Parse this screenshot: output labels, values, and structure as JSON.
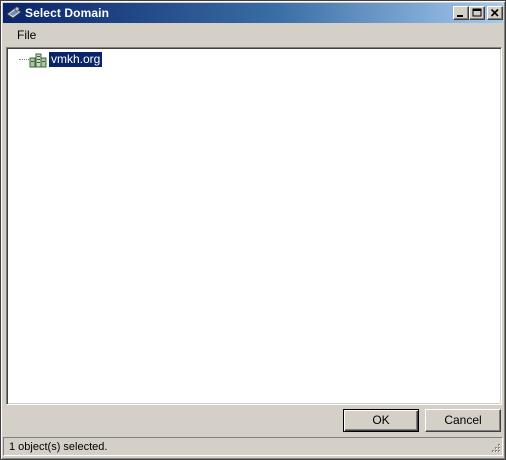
{
  "window": {
    "title": "Select Domain",
    "icon": "select-domain-app-icon"
  },
  "titlebar_buttons": {
    "minimize_icon": "minimize-icon",
    "maximize_icon": "maximize-icon",
    "close_icon": "close-icon"
  },
  "menu": {
    "items": [
      {
        "label": "File"
      }
    ]
  },
  "tree": {
    "nodes": [
      {
        "label": "vmkh.org",
        "icon": "domain-icon",
        "selected": true
      }
    ]
  },
  "buttons": {
    "ok_label": "OK",
    "cancel_label": "Cancel"
  },
  "status": {
    "text": "1 object(s) selected."
  },
  "colors": {
    "titlebar_start": "#0a246a",
    "titlebar_end": "#a6caf0",
    "selection": "#0a246a",
    "face": "#d4d0c8"
  }
}
